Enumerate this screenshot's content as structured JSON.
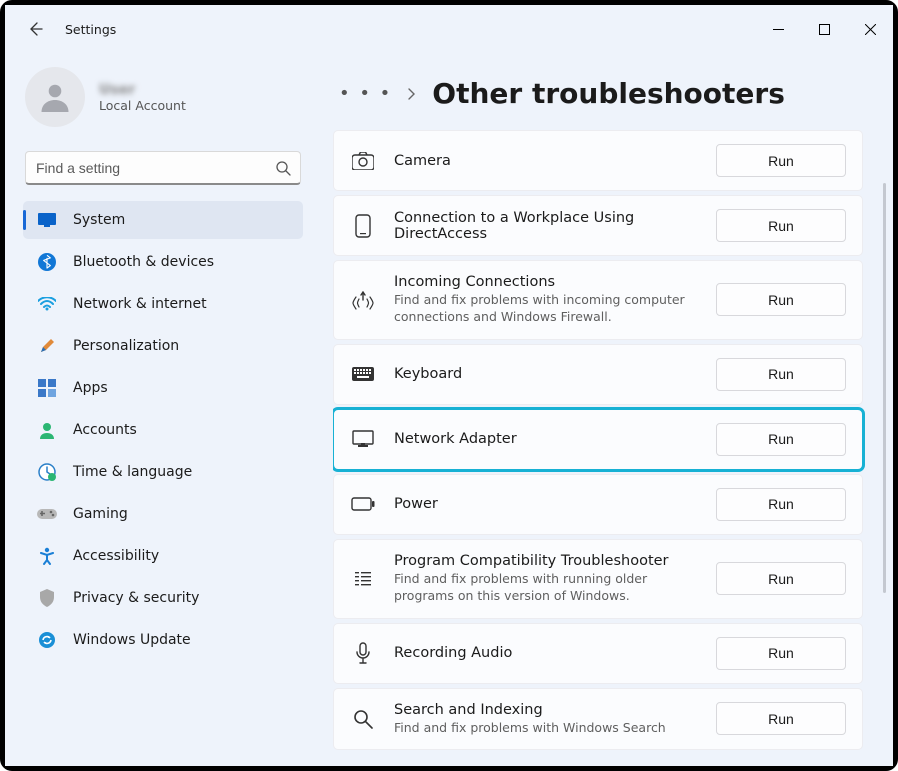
{
  "window": {
    "title": "Settings"
  },
  "user": {
    "name": "User",
    "sub": "Local Account"
  },
  "search": {
    "placeholder": "Find a setting"
  },
  "nav": [
    {
      "label": "System"
    },
    {
      "label": "Bluetooth & devices"
    },
    {
      "label": "Network & internet"
    },
    {
      "label": "Personalization"
    },
    {
      "label": "Apps"
    },
    {
      "label": "Accounts"
    },
    {
      "label": "Time & language"
    },
    {
      "label": "Gaming"
    },
    {
      "label": "Accessibility"
    },
    {
      "label": "Privacy & security"
    },
    {
      "label": "Windows Update"
    }
  ],
  "breadcrumb": {
    "title": "Other troubleshooters"
  },
  "run_label": "Run",
  "troubleshooters": [
    {
      "title": "Camera",
      "desc": ""
    },
    {
      "title": "Connection to a Workplace Using DirectAccess",
      "desc": ""
    },
    {
      "title": "Incoming Connections",
      "desc": "Find and fix problems with incoming computer connections and Windows Firewall."
    },
    {
      "title": "Keyboard",
      "desc": ""
    },
    {
      "title": "Network Adapter",
      "desc": ""
    },
    {
      "title": "Power",
      "desc": ""
    },
    {
      "title": "Program Compatibility Troubleshooter",
      "desc": "Find and fix problems with running older programs on this version of Windows."
    },
    {
      "title": "Recording Audio",
      "desc": ""
    },
    {
      "title": "Search and Indexing",
      "desc": "Find and fix problems with Windows Search"
    }
  ]
}
